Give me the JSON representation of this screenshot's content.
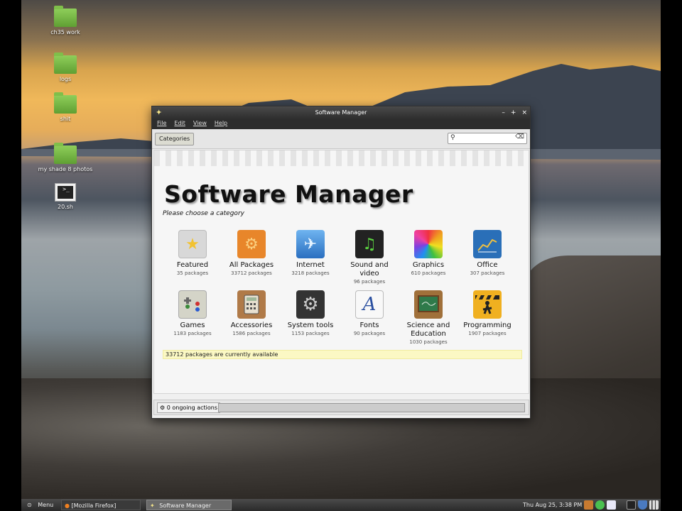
{
  "desktop": {
    "icons": [
      {
        "label": "ch35 work",
        "type": "folder"
      },
      {
        "label": "logs",
        "type": "folder"
      },
      {
        "label": "shit",
        "type": "folder"
      },
      {
        "label": "my shade 8 photos",
        "type": "folder"
      },
      {
        "label": "20.sh",
        "type": "terminal"
      }
    ]
  },
  "window": {
    "title": "Software Manager",
    "controls": [
      "–",
      "+",
      "×"
    ],
    "menu": [
      "File",
      "Edit",
      "View",
      "Help"
    ],
    "toolbar": {
      "categories_label": "Categories",
      "search_placeholder": "",
      "search_value": ""
    },
    "page": {
      "title": "Software Manager",
      "subtitle": "Please choose a category"
    },
    "categories": [
      {
        "name": "Featured",
        "count": "35 packages",
        "icon": "star-icon",
        "color": "#d8d8d8"
      },
      {
        "name": "All Packages",
        "count": "33712 packages",
        "icon": "gears-icon",
        "color": "#e8862a"
      },
      {
        "name": "Internet",
        "count": "3218 packages",
        "icon": "globe-icon",
        "color": "#3f8fd8"
      },
      {
        "name": "Sound and video",
        "count": "96 packages",
        "icon": "media-icon",
        "color": "#222222"
      },
      {
        "name": "Graphics",
        "count": "610 packages",
        "icon": "color-wheel-icon",
        "color": "#e04aa0"
      },
      {
        "name": "Office",
        "count": "307 packages",
        "icon": "chart-icon",
        "color": "#2a6fb8"
      },
      {
        "name": "Games",
        "count": "1183 packages",
        "icon": "gamepad-icon",
        "color": "#d4d4c8"
      },
      {
        "name": "Accessories",
        "count": "1586 packages",
        "icon": "calculator-icon",
        "color": "#b07a48"
      },
      {
        "name": "System tools",
        "count": "1153 packages",
        "icon": "system-gear-icon",
        "color": "#333333"
      },
      {
        "name": "Fonts",
        "count": "90 packages",
        "icon": "font-icon",
        "color": "#f4f4f4"
      },
      {
        "name": "Science and Education",
        "count": "1030 packages",
        "icon": "chalkboard-icon",
        "color": "#2f7a4a"
      },
      {
        "name": "Programming",
        "count": "1907 packages",
        "icon": "construction-icon",
        "color": "#f0b020"
      }
    ],
    "available_text": "33712 packages are currently available",
    "ongoing_text": "0 ongoing actions"
  },
  "taskbar": {
    "menu_label": "Menu",
    "tasks": [
      "[Mozilla Firefox]",
      "Software Manager"
    ],
    "clock": "Thu Aug 25,  3:38 PM"
  }
}
